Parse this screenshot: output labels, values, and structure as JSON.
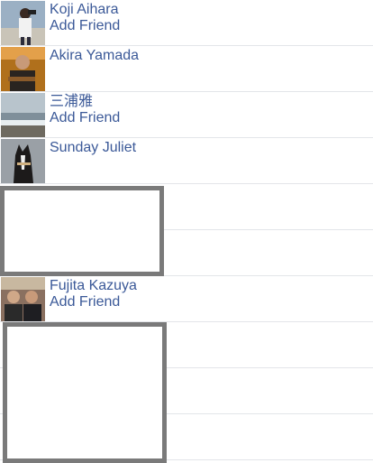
{
  "friends": [
    {
      "name": "Koji Aihara",
      "action": "Add Friend",
      "avatar_icon": "profile-photo-man-with-binoculars"
    },
    {
      "name": "Akira Yamada",
      "action": "",
      "avatar_icon": "profile-photo-man-with-guitar"
    },
    {
      "name": "三浦雅",
      "action": "Add Friend",
      "avatar_icon": "profile-photo-beach"
    },
    {
      "name": "Sunday Juliet",
      "action": "",
      "avatar_icon": "profile-photo-horse"
    },
    {
      "name": "",
      "action": "",
      "avatar_icon": ""
    },
    {
      "name": "",
      "action": "",
      "avatar_icon": ""
    },
    {
      "name": "Fujita Kazuya",
      "action": "Add Friend",
      "avatar_icon": "profile-photo-two-men"
    },
    {
      "name": "",
      "action": "",
      "avatar_icon": ""
    },
    {
      "name": "",
      "action": "",
      "avatar_icon": ""
    },
    {
      "name": "",
      "action": "",
      "avatar_icon": ""
    }
  ],
  "colors": {
    "link": "#3b5998",
    "divider": "#e3e5e9",
    "overlay_border": "#7a7a7a"
  }
}
